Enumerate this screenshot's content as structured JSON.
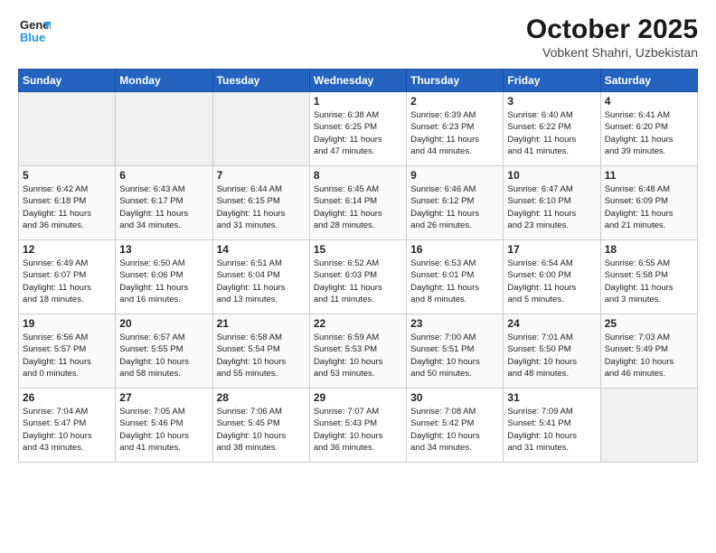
{
  "header": {
    "logo_line1": "General",
    "logo_line2": "Blue",
    "month": "October 2025",
    "location": "Vobkent Shahri, Uzbekistan"
  },
  "weekdays": [
    "Sunday",
    "Monday",
    "Tuesday",
    "Wednesday",
    "Thursday",
    "Friday",
    "Saturday"
  ],
  "weeks": [
    [
      {
        "day": "",
        "info": ""
      },
      {
        "day": "",
        "info": ""
      },
      {
        "day": "",
        "info": ""
      },
      {
        "day": "1",
        "info": "Sunrise: 6:38 AM\nSunset: 6:25 PM\nDaylight: 11 hours\nand 47 minutes."
      },
      {
        "day": "2",
        "info": "Sunrise: 6:39 AM\nSunset: 6:23 PM\nDaylight: 11 hours\nand 44 minutes."
      },
      {
        "day": "3",
        "info": "Sunrise: 6:40 AM\nSunset: 6:22 PM\nDaylight: 11 hours\nand 41 minutes."
      },
      {
        "day": "4",
        "info": "Sunrise: 6:41 AM\nSunset: 6:20 PM\nDaylight: 11 hours\nand 39 minutes."
      }
    ],
    [
      {
        "day": "5",
        "info": "Sunrise: 6:42 AM\nSunset: 6:18 PM\nDaylight: 11 hours\nand 36 minutes."
      },
      {
        "day": "6",
        "info": "Sunrise: 6:43 AM\nSunset: 6:17 PM\nDaylight: 11 hours\nand 34 minutes."
      },
      {
        "day": "7",
        "info": "Sunrise: 6:44 AM\nSunset: 6:15 PM\nDaylight: 11 hours\nand 31 minutes."
      },
      {
        "day": "8",
        "info": "Sunrise: 6:45 AM\nSunset: 6:14 PM\nDaylight: 11 hours\nand 28 minutes."
      },
      {
        "day": "9",
        "info": "Sunrise: 6:46 AM\nSunset: 6:12 PM\nDaylight: 11 hours\nand 26 minutes."
      },
      {
        "day": "10",
        "info": "Sunrise: 6:47 AM\nSunset: 6:10 PM\nDaylight: 11 hours\nand 23 minutes."
      },
      {
        "day": "11",
        "info": "Sunrise: 6:48 AM\nSunset: 6:09 PM\nDaylight: 11 hours\nand 21 minutes."
      }
    ],
    [
      {
        "day": "12",
        "info": "Sunrise: 6:49 AM\nSunset: 6:07 PM\nDaylight: 11 hours\nand 18 minutes."
      },
      {
        "day": "13",
        "info": "Sunrise: 6:50 AM\nSunset: 6:06 PM\nDaylight: 11 hours\nand 16 minutes."
      },
      {
        "day": "14",
        "info": "Sunrise: 6:51 AM\nSunset: 6:04 PM\nDaylight: 11 hours\nand 13 minutes."
      },
      {
        "day": "15",
        "info": "Sunrise: 6:52 AM\nSunset: 6:03 PM\nDaylight: 11 hours\nand 11 minutes."
      },
      {
        "day": "16",
        "info": "Sunrise: 6:53 AM\nSunset: 6:01 PM\nDaylight: 11 hours\nand 8 minutes."
      },
      {
        "day": "17",
        "info": "Sunrise: 6:54 AM\nSunset: 6:00 PM\nDaylight: 11 hours\nand 5 minutes."
      },
      {
        "day": "18",
        "info": "Sunrise: 6:55 AM\nSunset: 5:58 PM\nDaylight: 11 hours\nand 3 minutes."
      }
    ],
    [
      {
        "day": "19",
        "info": "Sunrise: 6:56 AM\nSunset: 5:57 PM\nDaylight: 11 hours\nand 0 minutes."
      },
      {
        "day": "20",
        "info": "Sunrise: 6:57 AM\nSunset: 5:55 PM\nDaylight: 10 hours\nand 58 minutes."
      },
      {
        "day": "21",
        "info": "Sunrise: 6:58 AM\nSunset: 5:54 PM\nDaylight: 10 hours\nand 55 minutes."
      },
      {
        "day": "22",
        "info": "Sunrise: 6:59 AM\nSunset: 5:53 PM\nDaylight: 10 hours\nand 53 minutes."
      },
      {
        "day": "23",
        "info": "Sunrise: 7:00 AM\nSunset: 5:51 PM\nDaylight: 10 hours\nand 50 minutes."
      },
      {
        "day": "24",
        "info": "Sunrise: 7:01 AM\nSunset: 5:50 PM\nDaylight: 10 hours\nand 48 minutes."
      },
      {
        "day": "25",
        "info": "Sunrise: 7:03 AM\nSunset: 5:49 PM\nDaylight: 10 hours\nand 46 minutes."
      }
    ],
    [
      {
        "day": "26",
        "info": "Sunrise: 7:04 AM\nSunset: 5:47 PM\nDaylight: 10 hours\nand 43 minutes."
      },
      {
        "day": "27",
        "info": "Sunrise: 7:05 AM\nSunset: 5:46 PM\nDaylight: 10 hours\nand 41 minutes."
      },
      {
        "day": "28",
        "info": "Sunrise: 7:06 AM\nSunset: 5:45 PM\nDaylight: 10 hours\nand 38 minutes."
      },
      {
        "day": "29",
        "info": "Sunrise: 7:07 AM\nSunset: 5:43 PM\nDaylight: 10 hours\nand 36 minutes."
      },
      {
        "day": "30",
        "info": "Sunrise: 7:08 AM\nSunset: 5:42 PM\nDaylight: 10 hours\nand 34 minutes."
      },
      {
        "day": "31",
        "info": "Sunrise: 7:09 AM\nSunset: 5:41 PM\nDaylight: 10 hours\nand 31 minutes."
      },
      {
        "day": "",
        "info": ""
      }
    ]
  ]
}
